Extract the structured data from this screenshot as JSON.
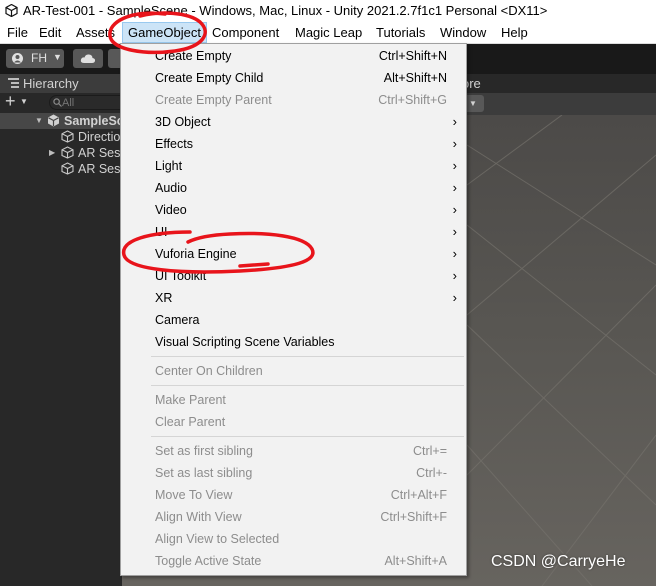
{
  "window": {
    "title": "AR-Test-001 - SampleScene - Windows, Mac, Linux - Unity 2021.2.7f1c1 Personal <DX11>"
  },
  "menubar": {
    "items": [
      "File",
      "Edit",
      "Assets",
      "GameObject",
      "Component",
      "Magic Leap",
      "Tutorials",
      "Window",
      "Help"
    ],
    "active": "GameObject"
  },
  "toolbar": {
    "account_label": "FH",
    "icons": [
      "account-icon",
      "chevron-down-icon",
      "cloud-icon"
    ]
  },
  "hierarchy": {
    "tab_label": "Hierarchy",
    "search_placeholder": "All",
    "tree": [
      {
        "label": "SampleScene",
        "kind": "scene",
        "expanded": true
      },
      {
        "label": "Directional Light",
        "kind": "object"
      },
      {
        "label": "AR Session Origin",
        "kind": "object",
        "collapsed": true
      },
      {
        "label": "AR Session",
        "kind": "object"
      }
    ]
  },
  "scene_panel": {
    "tab_tail": "ore"
  },
  "context_menu": {
    "groups": [
      [
        {
          "label": "Create Empty",
          "shortcut": "Ctrl+Shift+N",
          "enabled": true
        },
        {
          "label": "Create Empty Child",
          "shortcut": "Alt+Shift+N",
          "enabled": true
        },
        {
          "label": "Create Empty Parent",
          "shortcut": "Ctrl+Shift+G",
          "enabled": false
        },
        {
          "label": "3D Object",
          "submenu": true,
          "enabled": true
        },
        {
          "label": "Effects",
          "submenu": true,
          "enabled": true
        },
        {
          "label": "Light",
          "submenu": true,
          "enabled": true
        },
        {
          "label": "Audio",
          "submenu": true,
          "enabled": true
        },
        {
          "label": "Video",
          "submenu": true,
          "enabled": true
        },
        {
          "label": "UI",
          "submenu": true,
          "enabled": true
        },
        {
          "label": "Vuforia Engine",
          "submenu": true,
          "enabled": true
        },
        {
          "label": "UI Toolkit",
          "submenu": true,
          "enabled": true
        },
        {
          "label": "XR",
          "submenu": true,
          "enabled": true
        },
        {
          "label": "Camera",
          "enabled": true
        },
        {
          "label": "Visual Scripting Scene Variables",
          "enabled": true
        }
      ],
      [
        {
          "label": "Center On Children",
          "enabled": false
        }
      ],
      [
        {
          "label": "Make Parent",
          "enabled": false
        },
        {
          "label": "Clear Parent",
          "enabled": false
        }
      ],
      [
        {
          "label": "Set as first sibling",
          "shortcut": "Ctrl+=",
          "enabled": false
        },
        {
          "label": "Set as last sibling",
          "shortcut": "Ctrl+-",
          "enabled": false
        },
        {
          "label": "Move To View",
          "shortcut": "Ctrl+Alt+F",
          "enabled": false
        },
        {
          "label": "Align With View",
          "shortcut": "Ctrl+Shift+F",
          "enabled": false
        },
        {
          "label": "Align View to Selected",
          "enabled": false
        },
        {
          "label": "Toggle Active State",
          "shortcut": "Alt+Shift+A",
          "enabled": false
        }
      ]
    ]
  },
  "annotations": {
    "color": "#e8141b",
    "circled": [
      "GameObject",
      "Vuforia Engine"
    ]
  },
  "watermark": "CSDN @CarryeHe"
}
